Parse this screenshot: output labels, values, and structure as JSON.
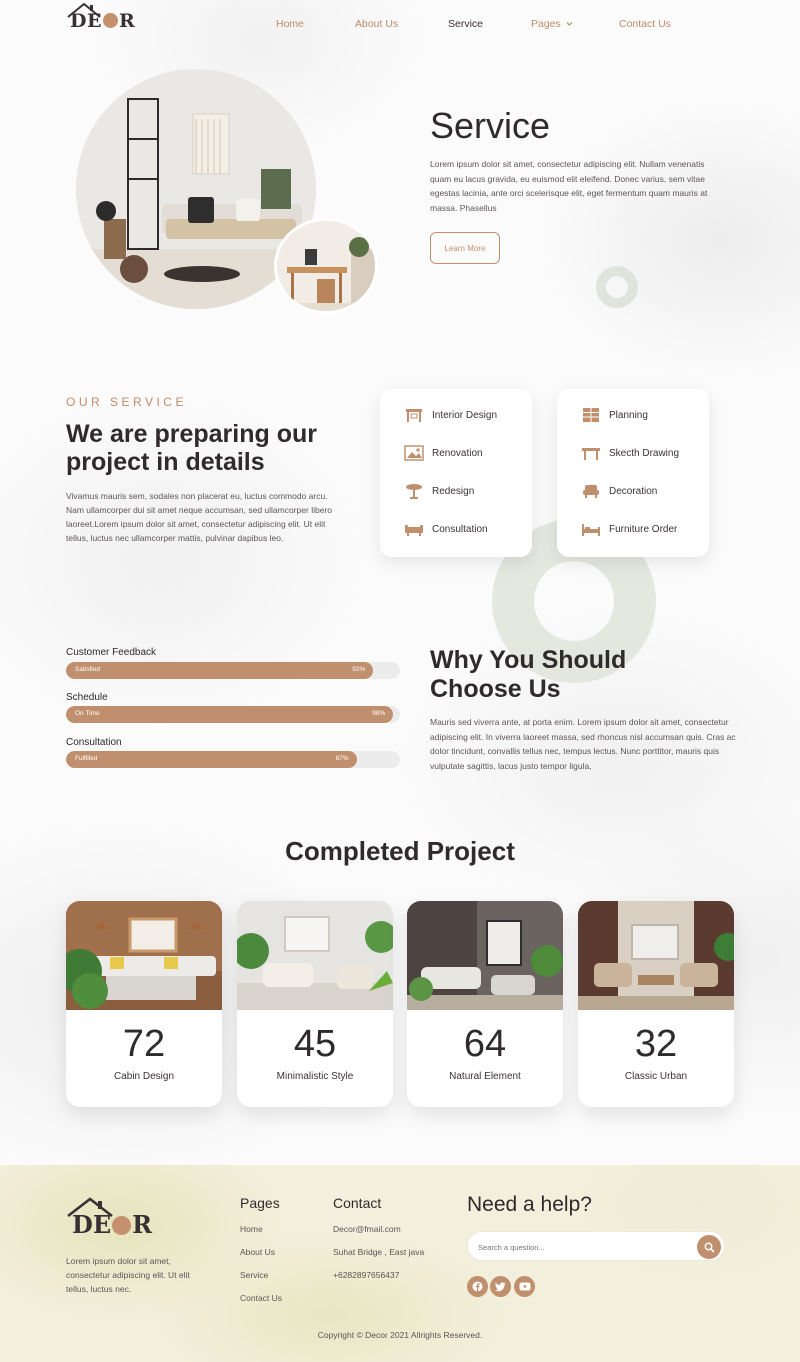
{
  "brand": {
    "logo_text_1": "D",
    "logo_text_2": "C",
    "logo_text_3": "R",
    "accent": "#c0906e",
    "dark": "#2f2a2c"
  },
  "nav": {
    "items": [
      {
        "label": "Home",
        "active": false
      },
      {
        "label": "About Us",
        "active": false
      },
      {
        "label": "Service",
        "active": true
      },
      {
        "label": "Pages",
        "active": false,
        "dropdown": true
      },
      {
        "label": "Contact Us",
        "active": false
      }
    ],
    "dropdown_icon": "chevron-down-icon"
  },
  "hero": {
    "title": "Service",
    "text": "Lorem ipsum dolor sit amet, consectetur adipiscing elit. Nullam venenatis quam eu lacus gravida, eu euismod elit eleifend. Donec varius, sem vitae egestas lacinia, ante orci scelerisque elit, eget fermentum quam mauris at massa. Phasellus",
    "button": "Learn More"
  },
  "our_service": {
    "kicker": "OUR SERVICE",
    "title": "We are preparing our project in details",
    "text": "Vivamus mauris sem, sodales non placerat eu, luctus commodo arcu. Nam ullamcorper dui sit amet neque accumsan, sed ullamcorper libero laoreet.Lorem ipsum dolor sit amet, consectetur adipiscing elit. Ut elit tellus, luctus nec ullamcorper mattis, pulvinar dapibus leo.",
    "cards": [
      {
        "items": [
          {
            "label": "Interior Design",
            "icon": "interior-design-icon"
          },
          {
            "label": "Renovation",
            "icon": "renovation-icon"
          },
          {
            "label": "Redesign",
            "icon": "redesign-icon"
          },
          {
            "label": "Consultation",
            "icon": "consultation-icon"
          }
        ]
      },
      {
        "items": [
          {
            "label": "Planning",
            "icon": "planning-icon"
          },
          {
            "label": "Skecth Drawing",
            "icon": "sketch-drawing-icon"
          },
          {
            "label": "Decoration",
            "icon": "decoration-icon"
          },
          {
            "label": "Furniture Order",
            "icon": "furniture-order-icon"
          }
        ]
      }
    ]
  },
  "progress": [
    {
      "label": "Customer Feedback",
      "status": "Satisfied",
      "value": 92,
      "pct_label": "92%"
    },
    {
      "label": "Schedule",
      "status": "On Time",
      "value": 98,
      "pct_label": "98%"
    },
    {
      "label": "Consultation",
      "status": "Fulfilled",
      "value": 87,
      "pct_label": "87%"
    }
  ],
  "why": {
    "title": "Why You Should Choose Us",
    "text": "Mauris sed viverra ante, at porta enim. Lorem ipsum dolor sit amet, consectetur adipiscing elit. In viverra laoreet massa, sed rhoncus nisl accumsan quis. Cras ac dolor tincidunt, convallis tellus nec, tempus lectus. Nunc porttitor, mauris quis vulputate sagittis, lacus justo tempor ligula,"
  },
  "projects": {
    "title": "Completed Project",
    "items": [
      {
        "number": "72",
        "label": "Cabin Design"
      },
      {
        "number": "45",
        "label": "Minimalistic Style"
      },
      {
        "number": "64",
        "label": "Natural Element"
      },
      {
        "number": "32",
        "label": "Classic Urban"
      }
    ]
  },
  "footer": {
    "about": "Lorem ipsum dolor sit amet, consectetur adipiscing elit. Ut elit tellus, luctus nec.",
    "pages_title": "Pages",
    "pages": [
      "Home",
      "About Us",
      "Service",
      "Contact Us"
    ],
    "contact_title": "Contact",
    "contact": [
      "Decor@fmail.com",
      "Suhat Bridge , East java",
      "+6282897656437"
    ],
    "help_title": "Need a help?",
    "search_placeholder": "Search a question...",
    "social": [
      "facebook-icon",
      "twitter-icon",
      "youtube-icon"
    ],
    "copyright": "Copyright © Decor 2021 Allrights Reserved."
  }
}
